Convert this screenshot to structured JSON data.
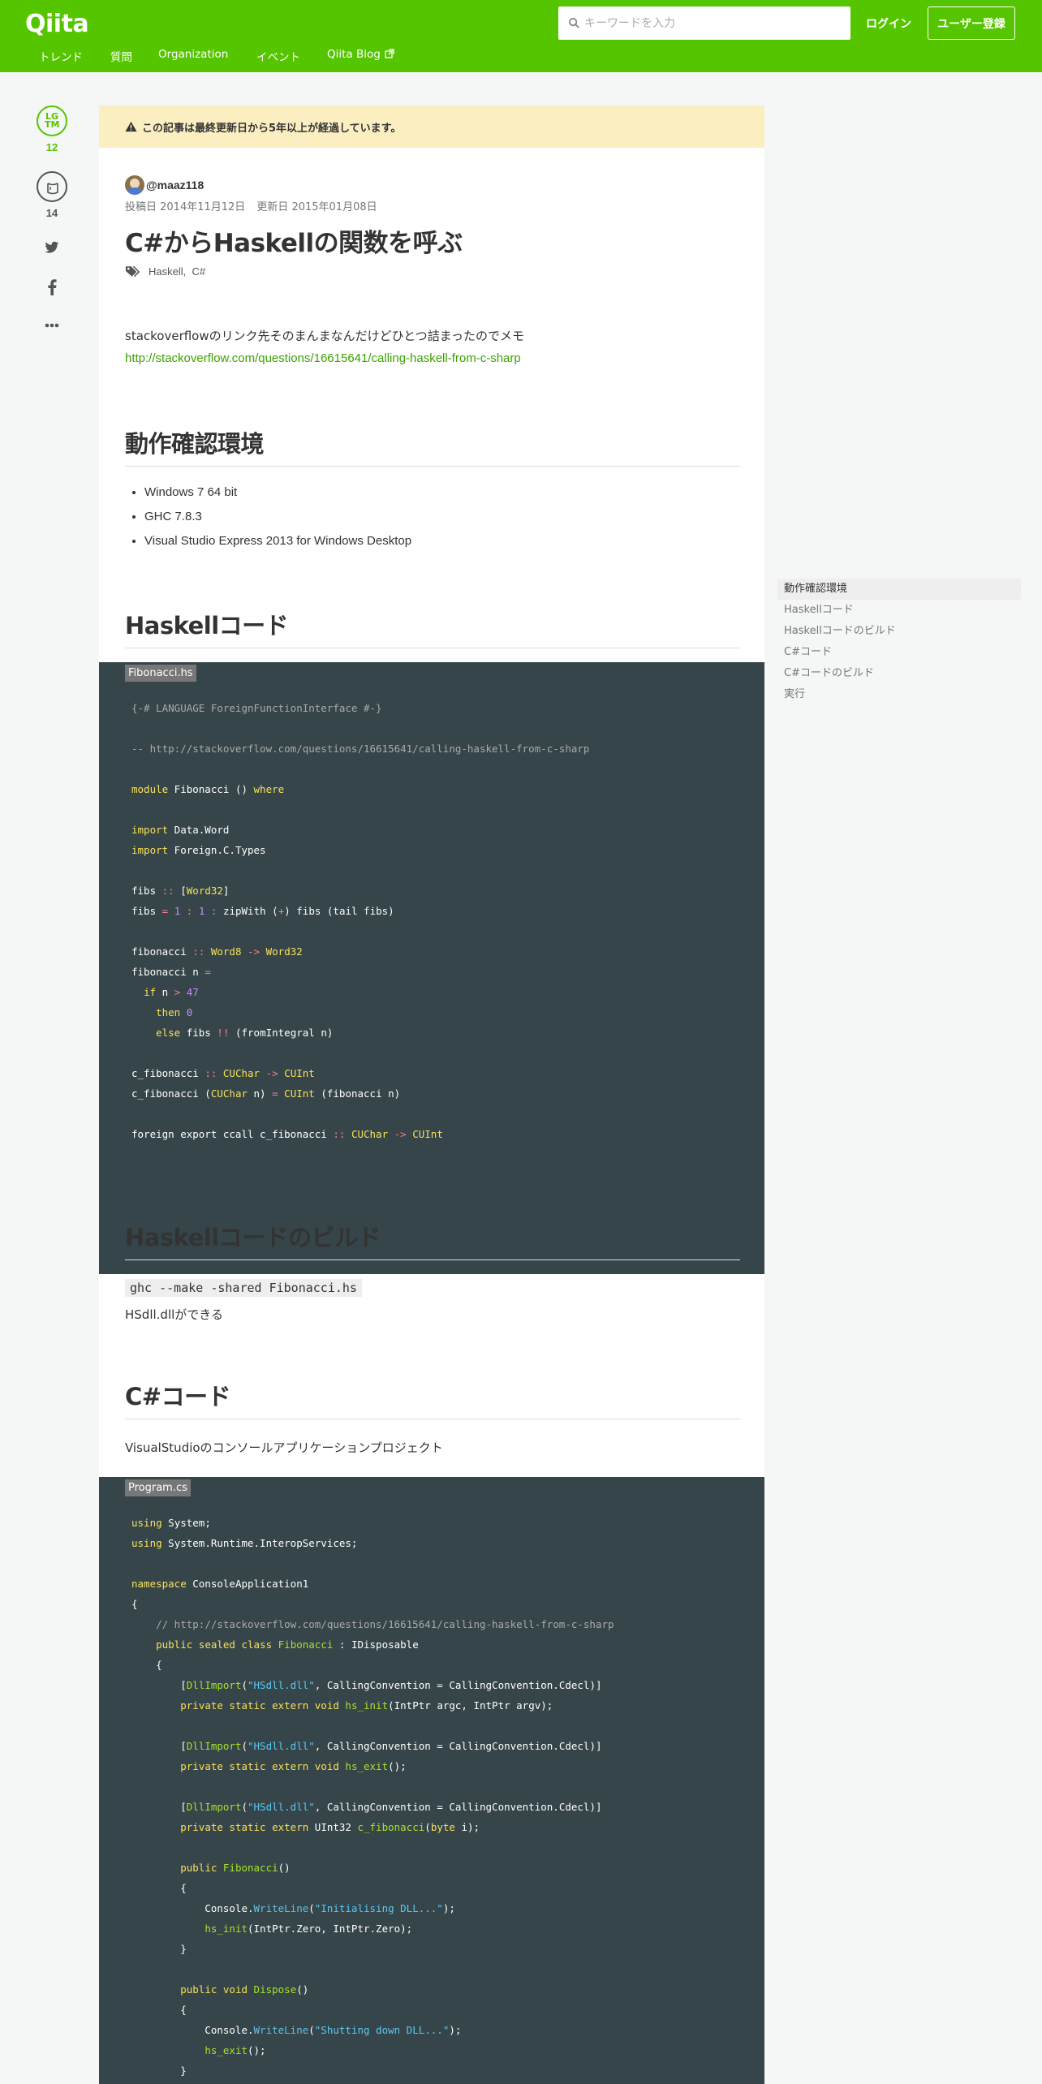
{
  "header": {
    "logo": "Qiita",
    "search_placeholder": "キーワードを入力",
    "login": "ログイン",
    "signup": "ユーザー登録",
    "nav": [
      "トレンド",
      "質問",
      "Organization",
      "イベント",
      "Qiita Blog"
    ],
    "brand_color": "#55c500"
  },
  "actions": {
    "lgtm_label": "LG TM",
    "lgtm_count": "12",
    "stock_count": "14",
    "icons": [
      "lgtm-icon",
      "stock-icon",
      "twitter-icon",
      "facebook-icon",
      "more-icon"
    ]
  },
  "article": {
    "warning": "この記事は最終更新日から5年以上が経過しています。",
    "author": "@maaz118",
    "posted": "投稿日 2014年11月12日",
    "updated": "更新日 2015年01月08日",
    "title": "C#からHaskellの関数を呼ぶ",
    "tags": [
      "Haskell",
      "C#"
    ],
    "intro": "stackoverflowのリンク先そのまんまなんだけどひとつ詰まったのでメモ",
    "link": "http://stackoverflow.com/questions/16615641/calling-haskell-from-c-sharp",
    "h_env": "動作確認環境",
    "env_items": [
      "Windows 7 64 bit",
      "GHC 7.8.3",
      "Visual Studio Express 2013 for Windows Desktop"
    ],
    "h_haskell": "Haskellコード",
    "haskell_file": "Fibonacci.hs",
    "h_build": "Haskellコードのビルド",
    "build_cmd": "ghc --make -shared Fibonacci.hs",
    "build_result": "HSdll.dllができる",
    "h_csharp": "C#コード",
    "csharp_desc": "VisualStudioのコンソールアプリケーションプロジェクト",
    "csharp_file": "Program.cs"
  },
  "toc": [
    "動作確認環境",
    "Haskellコード",
    "Haskellコードのビルド",
    "C#コード",
    "C#コードのビルド",
    "実行"
  ]
}
